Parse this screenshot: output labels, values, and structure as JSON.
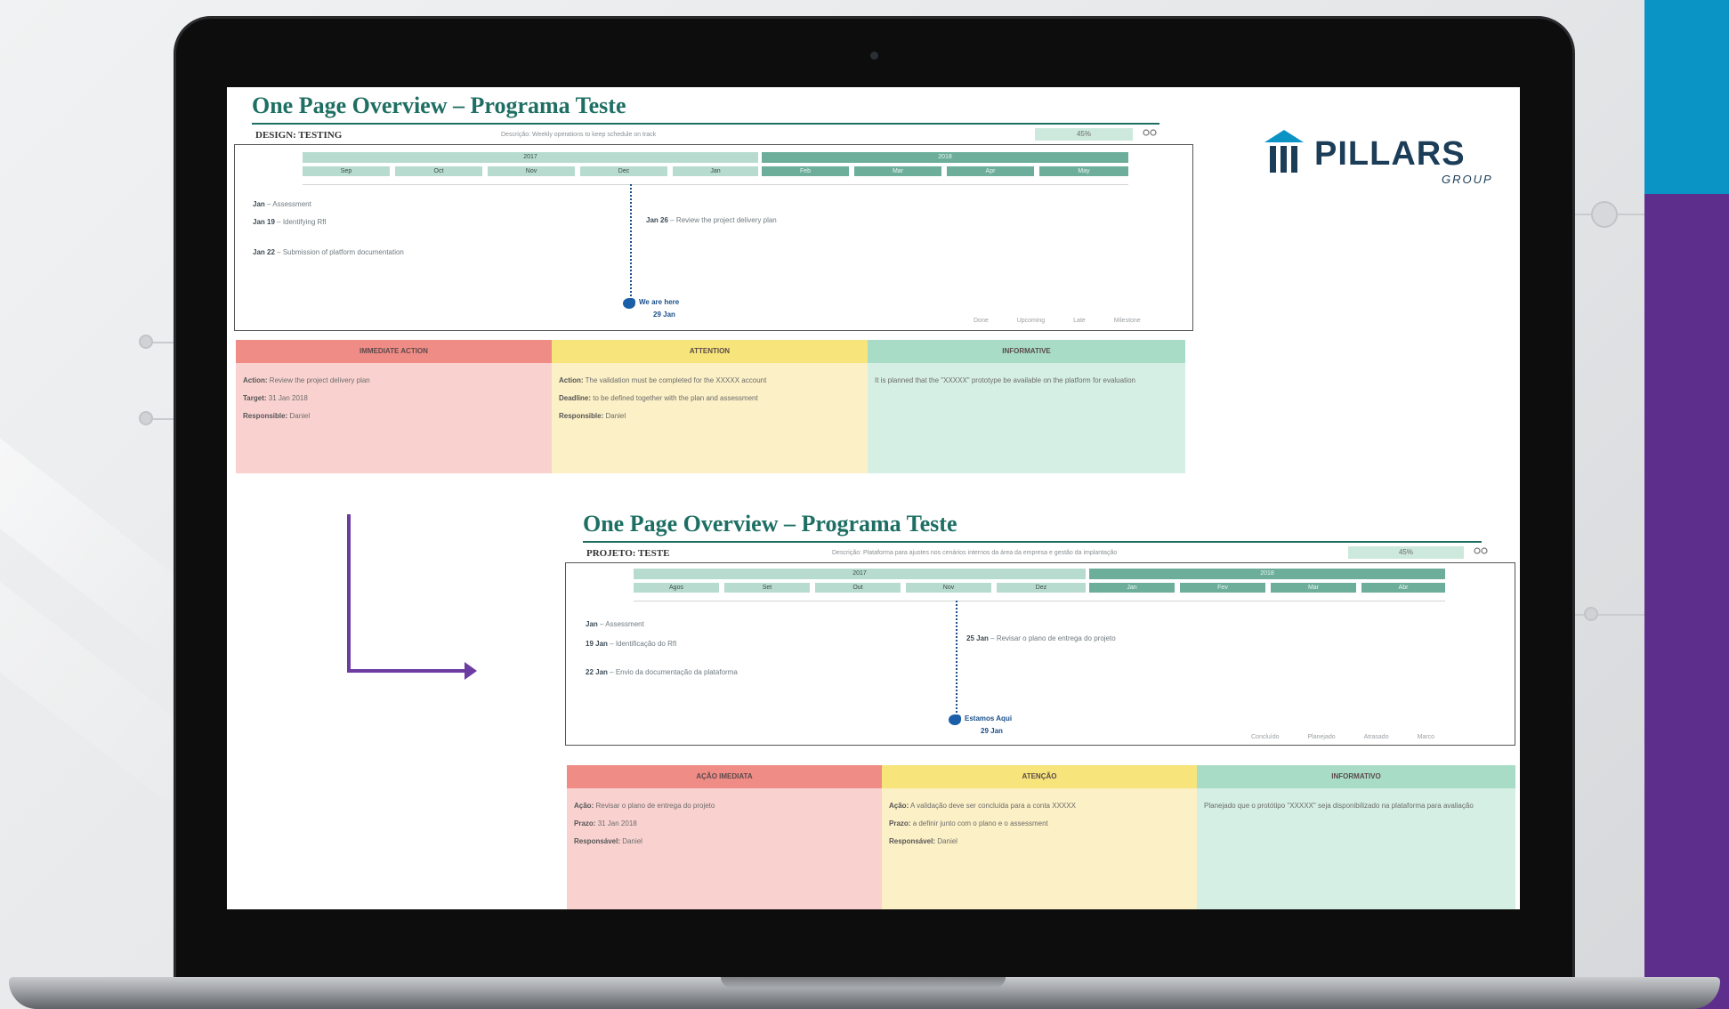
{
  "brand": {
    "logo_text": "PILLARS",
    "logo_sub": "GROUP",
    "colors": {
      "blue": "#0a94c6",
      "purple": "#5d2e8c",
      "teal": "#1e6f63"
    }
  },
  "overview_top": {
    "title": "One Page Overview – Programa Teste",
    "project": "DESIGN: TESTING",
    "description": "Descrição: Weekly operations to keep schedule on track",
    "progress": "45%",
    "progress_value": 0.45,
    "years": [
      "2017",
      "2018"
    ],
    "months": [
      "Sep",
      "Oct",
      "Nov",
      "Dec",
      "Jan",
      "Feb",
      "Mar",
      "Apr",
      "May"
    ],
    "events_left": [
      {
        "date": "Jan",
        "text": "Assessment"
      },
      {
        "date": "Jan 19",
        "text": "Identifying RfI"
      },
      {
        "date": "Jan 22",
        "text": "Submission of platform documentation"
      }
    ],
    "events_right": [
      {
        "date": "Jan 26",
        "text": "Review the project delivery plan"
      }
    ],
    "now_label": "We are here",
    "now_date": "29 Jan",
    "legend": [
      "Done",
      "Upcoming",
      "Late",
      "Milestone"
    ],
    "panels": {
      "red": {
        "header": "IMMEDIATE ACTION",
        "rows": [
          {
            "k": "Action:",
            "v": "Review the project delivery plan"
          },
          {
            "k": "Target:",
            "v": "31 Jan 2018"
          },
          {
            "k": "Responsible:",
            "v": "Daniel"
          }
        ]
      },
      "yellow": {
        "header": "ATTENTION",
        "rows": [
          {
            "k": "Action:",
            "v": "The validation must be completed for the XXXXX account"
          },
          {
            "k": "Deadline:",
            "v": "to be defined together with the plan and assessment"
          },
          {
            "k": "Responsible:",
            "v": "Daniel"
          }
        ]
      },
      "green": {
        "header": "INFORMATIVE",
        "rows": [
          {
            "k": "",
            "v": "It is planned that the \"XXXXX\" prototype be available on the platform for evaluation"
          }
        ]
      }
    }
  },
  "overview_bottom": {
    "title": "One Page Overview – Programa Teste",
    "project": "PROJETO: TESTE",
    "description": "Descrição: Plataforma para ajustes nos cenários internos da área da empresa e gestão da implantação",
    "progress": "45%",
    "progress_value": 0.45,
    "years": [
      "2017",
      "2018"
    ],
    "months": [
      "Agos",
      "Set",
      "Out",
      "Nov",
      "Dez",
      "Jan",
      "Fev",
      "Mar",
      "Abr"
    ],
    "events_left": [
      {
        "date": "Jan",
        "text": "Assessment"
      },
      {
        "date": "19 Jan",
        "text": "Identificação do RfI"
      },
      {
        "date": "22 Jan",
        "text": "Envio da documentação da plataforma"
      }
    ],
    "events_right": [
      {
        "date": "25 Jan",
        "text": "Revisar o plano de entrega do projeto"
      }
    ],
    "now_label": "Estamos Aqui",
    "now_date": "29 Jan",
    "legend": [
      "Concluído",
      "Planejado",
      "Atrasado",
      "Marco"
    ],
    "panels": {
      "red": {
        "header": "AÇÃO IMEDIATA",
        "rows": [
          {
            "k": "Ação:",
            "v": "Revisar o plano de entrega do projeto"
          },
          {
            "k": "Prazo:",
            "v": "31 Jan 2018"
          },
          {
            "k": "Responsável:",
            "v": "Daniel"
          }
        ]
      },
      "yellow": {
        "header": "ATENÇÃO",
        "rows": [
          {
            "k": "Ação:",
            "v": "A validação deve ser concluída para a conta XXXXX"
          },
          {
            "k": "Prazo:",
            "v": "a definir junto com o plano e o assessment"
          },
          {
            "k": "Responsável:",
            "v": "Daniel"
          }
        ]
      },
      "green": {
        "header": "INFORMATIVO",
        "rows": [
          {
            "k": "",
            "v": "Planejado que o protótipo \"XXXXX\" seja disponibilizado na plataforma para avaliação"
          }
        ]
      }
    }
  }
}
